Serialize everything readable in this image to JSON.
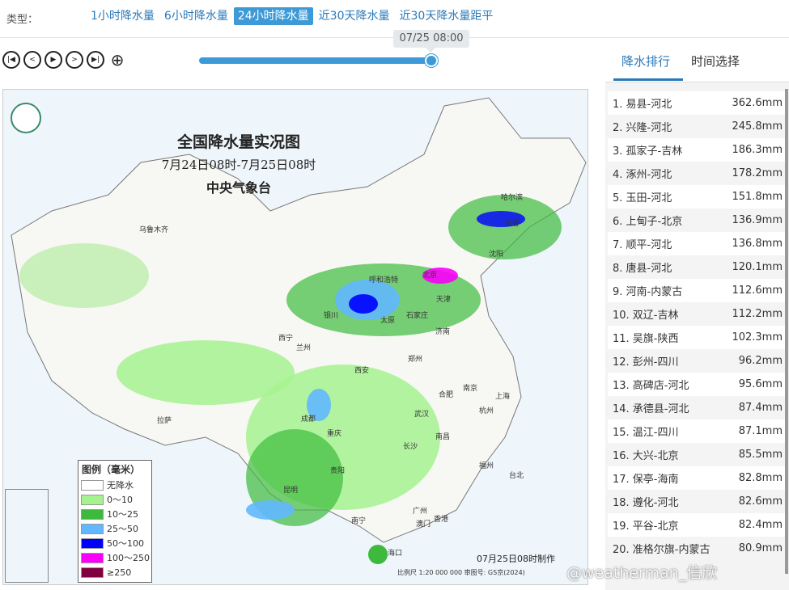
{
  "header": {
    "type_label": "类型：",
    "tabs": [
      {
        "label": "1小时降水量",
        "active": false
      },
      {
        "label": "6小时降水量",
        "active": false
      },
      {
        "label": "24小时降水量",
        "active": true
      },
      {
        "label": "近30天降水量",
        "active": false
      },
      {
        "label": "近30天降水量距平",
        "active": false
      }
    ]
  },
  "player": {
    "current_time": "07/25 08:00",
    "progress": 1.0
  },
  "map": {
    "title": "全国降水量实况图",
    "subtitle": "7月24日08时-7月25日08时",
    "agency": "中央气象台",
    "made_text": "07月25日08时制作",
    "scale_text": "比例尺 1:20 000 000   审图号: GS京(2024)",
    "cities": [
      "乌鲁木齐",
      "拉萨",
      "西宁",
      "兰州",
      "银川",
      "呼和浩特",
      "北京",
      "天津",
      "石家庄",
      "太原",
      "济南",
      "郑州",
      "西安",
      "成都",
      "重庆",
      "武汉",
      "合肥",
      "南京",
      "上海",
      "杭州",
      "长沙",
      "南昌",
      "福州",
      "贵阳",
      "昆明",
      "南宁",
      "广州",
      "香港",
      "澳门",
      "海口",
      "哈尔滨",
      "长春",
      "沈阳",
      "台北"
    ],
    "legend": {
      "title": "图例（毫米）",
      "items": [
        {
          "label": "无降水",
          "color": "#ffffff"
        },
        {
          "label": "0～10",
          "color": "#a6f28f"
        },
        {
          "label": "10～25",
          "color": "#3dba3d"
        },
        {
          "label": "25～50",
          "color": "#61b8ff"
        },
        {
          "label": "50～100",
          "color": "#0000ff"
        },
        {
          "label": "100～250",
          "color": "#fa00fa"
        },
        {
          "label": "≥250",
          "color": "#800040"
        }
      ]
    }
  },
  "sidebar": {
    "tabs": [
      {
        "label": "降水排行",
        "active": true
      },
      {
        "label": "时间选择",
        "active": false
      }
    ],
    "rankings": [
      {
        "name": "1. 易县-河北",
        "value": "362.6mm"
      },
      {
        "name": "2. 兴隆-河北",
        "value": "245.8mm"
      },
      {
        "name": "3. 孤家子-吉林",
        "value": "186.3mm"
      },
      {
        "name": "4. 涿州-河北",
        "value": "178.2mm"
      },
      {
        "name": "5. 玉田-河北",
        "value": "151.8mm"
      },
      {
        "name": "6. 上甸子-北京",
        "value": "136.9mm"
      },
      {
        "name": "7. 顺平-河北",
        "value": "136.8mm"
      },
      {
        "name": "8. 唐县-河北",
        "value": "120.1mm"
      },
      {
        "name": "9. 河南-内蒙古",
        "value": "112.6mm"
      },
      {
        "name": "10. 双辽-吉林",
        "value": "112.2mm"
      },
      {
        "name": "11. 吴旗-陕西",
        "value": "102.3mm"
      },
      {
        "name": "12. 彭州-四川",
        "value": "96.2mm"
      },
      {
        "name": "13. 高碑店-河北",
        "value": "95.6mm"
      },
      {
        "name": "14. 承德县-河北",
        "value": "87.4mm"
      },
      {
        "name": "15. 温江-四川",
        "value": "87.1mm"
      },
      {
        "name": "16. 大兴-北京",
        "value": "85.5mm"
      },
      {
        "name": "17. 保亭-海南",
        "value": "82.8mm"
      },
      {
        "name": "18. 遵化-河北",
        "value": "82.6mm"
      },
      {
        "name": "19. 平谷-北京",
        "value": "82.4mm"
      },
      {
        "name": "20. 准格尔旗-内蒙古",
        "value": "80.9mm"
      }
    ]
  },
  "watermark": "@weatherman_信欣"
}
